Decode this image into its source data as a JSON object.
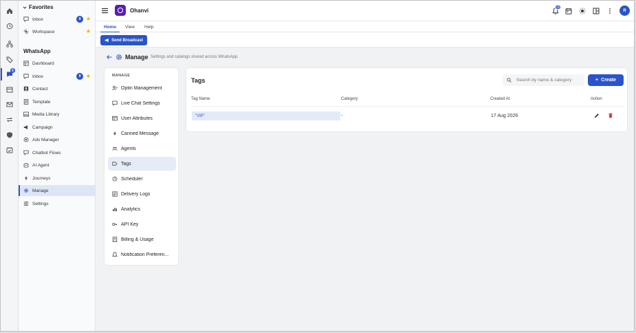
{
  "app": {
    "brand": "Ohanvi",
    "avatar_initial": "R",
    "notifications_count": "29"
  },
  "rail": {
    "chat_badge": "6"
  },
  "sidebar": {
    "favorites_title": "Favorites",
    "favorites": [
      {
        "label": "Inbox",
        "badge": "9",
        "icon": "inbox-icon"
      },
      {
        "label": "Workspace",
        "icon": "workspace-icon"
      }
    ],
    "section_title": "WhatsApp",
    "items": [
      {
        "label": "Dashboard",
        "icon": "dashboard-icon"
      },
      {
        "label": "Inbox",
        "badge": "9",
        "icon": "inbox-icon"
      },
      {
        "label": "Contact",
        "icon": "contact-icon"
      },
      {
        "label": "Template",
        "icon": "template-icon"
      },
      {
        "label": "Media Library",
        "icon": "media-icon"
      },
      {
        "label": "Campaign",
        "icon": "campaign-icon"
      },
      {
        "label": "Ads Manager",
        "icon": "ads-icon"
      },
      {
        "label": "Chatbot Flows",
        "icon": "flow-icon"
      },
      {
        "label": "AI Agent",
        "icon": "ai-icon"
      },
      {
        "label": "Journeys",
        "icon": "bolt-icon"
      },
      {
        "label": "Manage",
        "icon": "gear-icon",
        "active": true
      },
      {
        "label": "Settings",
        "icon": "sliders-icon"
      }
    ]
  },
  "tabs": [
    "Home",
    "View",
    "Help"
  ],
  "ribbon": {
    "broadcast_label": "Send Broadcast"
  },
  "header": {
    "title": "Manage",
    "subtitle": "Settings and catalogs shared across WhatsApp."
  },
  "menu": {
    "heading": "MANAGE",
    "items": [
      "Optin Management",
      "Live Chat Settings",
      "User Attributes",
      "Canned Message",
      "Agents",
      "Tags",
      "Scheduler",
      "Delivery Logs",
      "Analytics",
      "API Key",
      "Billing & Usage",
      "Notification Preferen..."
    ],
    "active": "Tags"
  },
  "tags": {
    "title": "Tags",
    "search_placeholder": "Search by name & category",
    "create_label": "Create",
    "columns": [
      "Tag Name",
      "Category",
      "Created At",
      "Action"
    ],
    "rows": [
      {
        "name": "\"VIP\"",
        "category": "-",
        "created_at": "17 Aug 2026"
      }
    ]
  },
  "colors": {
    "accent": "#2b54c9",
    "brand": "#5a1fb0",
    "star": "#e7b100",
    "delete": "#d33a3a"
  }
}
